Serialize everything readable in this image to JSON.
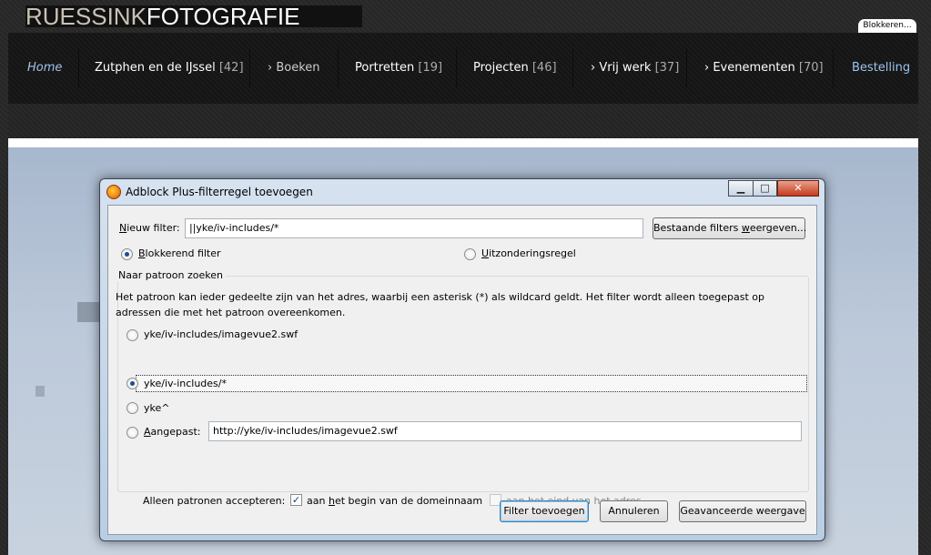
{
  "site": {
    "logo_light": "RUESSINK",
    "logo_bold": "FOTOGRAFIE",
    "block_badge": "Blokkeren..."
  },
  "nav": {
    "items": [
      {
        "label": "Home",
        "count": ""
      },
      {
        "label": "Zutphen en de IJssel",
        "count": "[42]"
      },
      {
        "label": "Boeken",
        "count": ""
      },
      {
        "label": "Portretten",
        "count": "[19]"
      },
      {
        "label": "Projecten",
        "count": "[46]"
      },
      {
        "label": "Vrij werk",
        "count": "[37]"
      },
      {
        "label": "Evenementen",
        "count": "[70]"
      },
      {
        "label": "Bestelling",
        "count": ""
      }
    ],
    "arrow": "›",
    "colors": {
      "highlight": "#9cc3ef",
      "text": "#ffffff",
      "count": "#aaaaaa"
    }
  },
  "dialog": {
    "title": "Adblock Plus-filterregel toevoegen",
    "window_buttons": {
      "minimize": "▁",
      "maximize": "□",
      "close": "✕"
    },
    "new_filter": {
      "label_pre": "",
      "label_underline": "N",
      "label_post": "ieuw filter:",
      "value": "||yke/iv-includes/*"
    },
    "existing_button": {
      "pre": "Bestaande filters ",
      "underline": "w",
      "post": "eergeven..."
    },
    "blocking": {
      "underline": "B",
      "post": "lokkerend filter",
      "selected": true
    },
    "exception": {
      "underline": "U",
      "post": "itzonderingsregel",
      "selected": false
    },
    "pattern_group": {
      "title": "Naar patroon zoeken",
      "description": "Het patroon kan ieder gedeelte zijn van het adres, waarbij een asterisk (*) als wildcard geldt. Het filter wordt alleen toegepast op adressen die met het patroon overeenkomen.",
      "options": [
        {
          "label": "yke/iv-includes/imagevue2.swf",
          "selected": false
        },
        {
          "label": "yke/iv-includes/*",
          "selected": true
        },
        {
          "label": "yke^",
          "selected": false
        }
      ],
      "custom": {
        "underline": "A",
        "post": "angepast:",
        "value": "http://yke/iv-includes/imagevue2.swf",
        "selected": false
      }
    },
    "accept": {
      "label": "Alleen patronen accepteren:",
      "begin": {
        "pre": "aan ",
        "underline": "h",
        "post": "et begin van de domeinnaam",
        "checked": true
      },
      "end": {
        "pre": "aan h",
        "underline": "e",
        "post": "t eind van het adres",
        "checked": false
      }
    },
    "buttons": {
      "add": "Filter toevoegen",
      "cancel": "Annuleren",
      "advanced": "Geavanceerde weergave"
    }
  }
}
